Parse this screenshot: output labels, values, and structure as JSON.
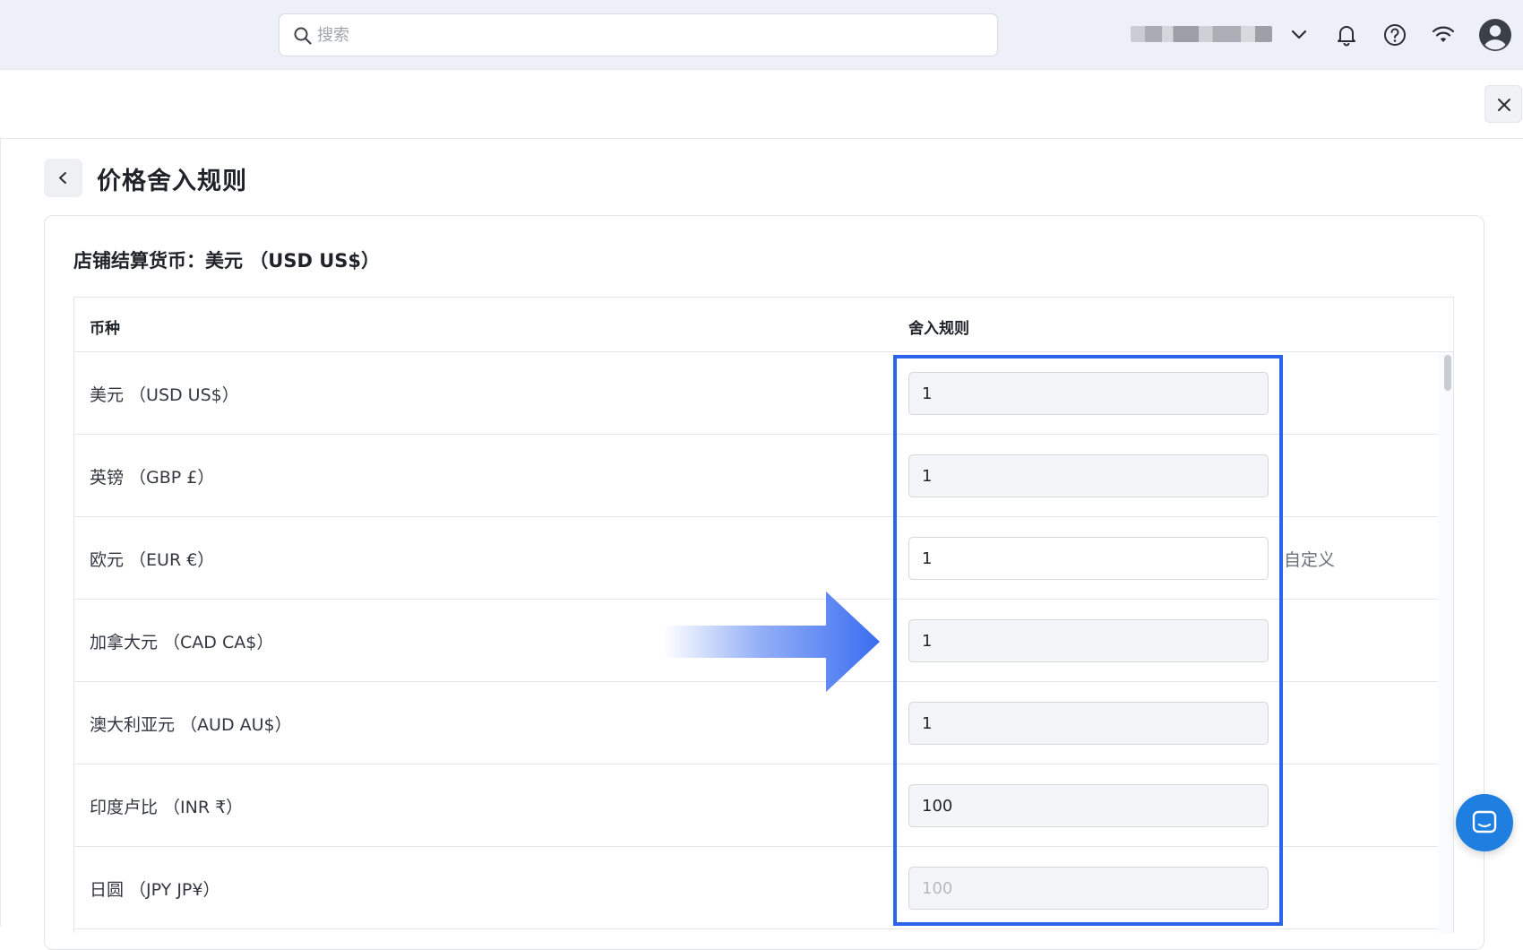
{
  "topbar": {
    "search": {
      "placeholder": "搜索",
      "value": ""
    },
    "icons": [
      "search-icon",
      "chevron-down-icon",
      "bell-icon",
      "help-icon",
      "wifi-icon",
      "user-avatar-icon"
    ]
  },
  "page": {
    "title": "价格舍入规则",
    "settlement_currency_label": "店铺结算货币：美元 （USD US$）"
  },
  "table": {
    "headers": {
      "currency": "币种",
      "rule": "舍入规则"
    },
    "rows": [
      {
        "currency": "美元 （USD US$）",
        "value": "1",
        "placeholder": "",
        "extra": ""
      },
      {
        "currency": "英镑 （GBP £）",
        "value": "1",
        "placeholder": "",
        "extra": ""
      },
      {
        "currency": "欧元 （EUR €）",
        "value": "1",
        "placeholder": "",
        "extra": "自定义"
      },
      {
        "currency": "加拿大元 （CAD CA$）",
        "value": "1",
        "placeholder": "",
        "extra": ""
      },
      {
        "currency": "澳大利亚元 （AUD AU$）",
        "value": "1",
        "placeholder": "",
        "extra": ""
      },
      {
        "currency": "印度卢比 （INR ₹）",
        "value": "100",
        "placeholder": "",
        "extra": ""
      },
      {
        "currency": "日圆 （JPY JP¥）",
        "value": "",
        "placeholder": "100",
        "extra": ""
      }
    ]
  },
  "colors": {
    "topbar_bg": "#edf0f8",
    "highlight_border": "#2b63eb",
    "arrow": "#3a6df0",
    "chat_button": "#1f7fe0"
  }
}
